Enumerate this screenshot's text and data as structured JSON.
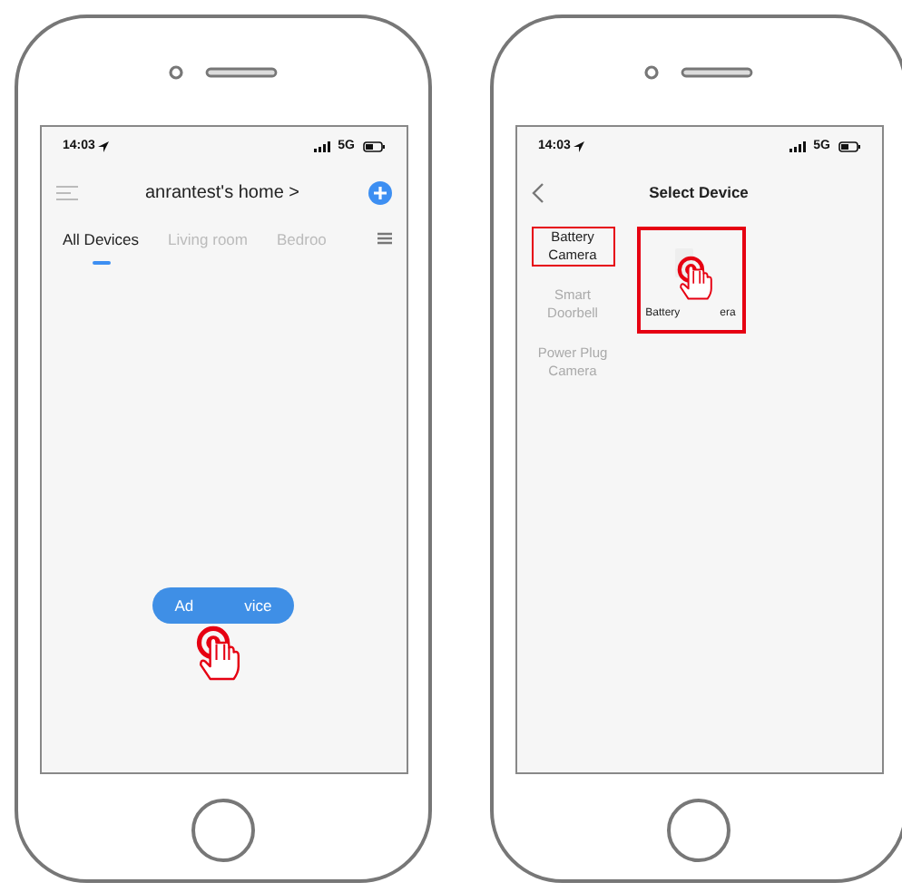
{
  "phones": [
    {
      "kind": "home",
      "status": {
        "time": "14:03",
        "network": "5G"
      },
      "title": "anrantest's home",
      "title_arrow": ">",
      "tabs": [
        {
          "label": "All Devices",
          "selected": true
        },
        {
          "label": "Living room",
          "selected": false
        },
        {
          "label": "Bedroo",
          "selected": false
        }
      ],
      "add_button": {
        "label_parts": [
          "Ad",
          "vice"
        ]
      }
    },
    {
      "kind": "select",
      "status": {
        "time": "14:03",
        "network": "5G"
      },
      "title": "Select Device",
      "categories": [
        {
          "label": "Battery Camera",
          "selected": true
        },
        {
          "label": "Smart Doorbell",
          "selected": false
        },
        {
          "label": "Power Plug Camera",
          "selected": false
        }
      ],
      "device_label_parts": [
        "Battery",
        "era"
      ]
    }
  ]
}
